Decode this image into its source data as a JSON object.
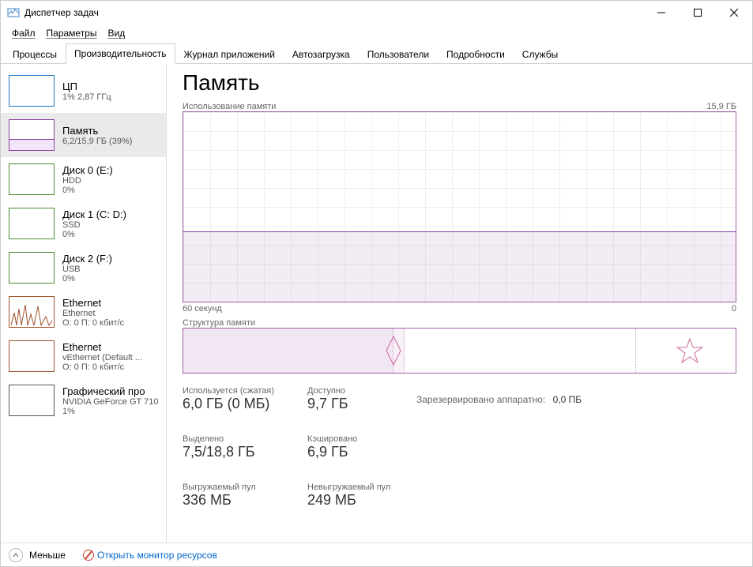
{
  "window": {
    "title": "Диспетчер задач"
  },
  "menu": [
    "Файл",
    "Параметры",
    "Вид"
  ],
  "tabs": [
    "Процессы",
    "Производительность",
    "Журнал приложений",
    "Автозагрузка",
    "Пользователи",
    "Подробности",
    "Службы"
  ],
  "tabs_active_index": 1,
  "sidebar": [
    {
      "title": "ЦП",
      "sub1": "1% 2,87 ГГц",
      "sub2": ""
    },
    {
      "title": "Память",
      "sub1": "6,2/15,9 ГБ (39%)",
      "sub2": ""
    },
    {
      "title": "Диск 0 (E:)",
      "sub1": "HDD",
      "sub2": "0%"
    },
    {
      "title": "Диск 1 (C: D:)",
      "sub1": "SSD",
      "sub2": "0%"
    },
    {
      "title": "Диск 2 (F:)",
      "sub1": "USB",
      "sub2": "0%"
    },
    {
      "title": "Ethernet",
      "sub1": "Ethernet",
      "sub2": "О: 0 П: 0 кбит/с"
    },
    {
      "title": "Ethernet",
      "sub1": "vEthernet (Default ...",
      "sub2": "О: 0 П: 0 кбит/с"
    },
    {
      "title": "Графический про",
      "sub1": "NVIDIA GeForce GT 710",
      "sub2": "1%"
    }
  ],
  "sidebar_selected_index": 1,
  "main": {
    "heading": "Память",
    "usage_label": "Использование памяти",
    "usage_max": "15,9 ГБ",
    "x_left": "60 секунд",
    "x_right": "0",
    "composition_label": "Структура памяти"
  },
  "stats": {
    "in_use_label": "Используется (сжатая)",
    "in_use_value": "6,0 ГБ (0 МБ)",
    "available_label": "Доступно",
    "available_value": "9,7 ГБ",
    "committed_label": "Выделено",
    "committed_value": "7,5/18,8 ГБ",
    "cached_label": "Кэшировано",
    "cached_value": "6,9 ГБ",
    "paged_label": "Выгружаемый пул",
    "paged_value": "336 МБ",
    "nonpaged_label": "Невыгружаемый пул",
    "nonpaged_value": "249 МБ",
    "hw_reserved_label": "Зарезервировано аппаратно:",
    "hw_reserved_value": "0,0 ПБ"
  },
  "chart_data": {
    "type": "area",
    "title": "Использование памяти",
    "xlabel": "секунд",
    "ylabel": "ГБ",
    "xlim": [
      60,
      0
    ],
    "ylim": [
      0,
      15.9
    ],
    "series": [
      {
        "name": "Память",
        "x": [
          60,
          55,
          50,
          45,
          40,
          35,
          30,
          25,
          20,
          15,
          10,
          5,
          0
        ],
        "y": [
          6.0,
          6.0,
          6.0,
          6.0,
          6.0,
          6.0,
          6.0,
          6.0,
          6.0,
          6.0,
          5.9,
          6.1,
          6.0
        ]
      }
    ]
  },
  "footer": {
    "fewer": "Меньше",
    "open_resmon": "Открыть монитор ресурсов"
  }
}
